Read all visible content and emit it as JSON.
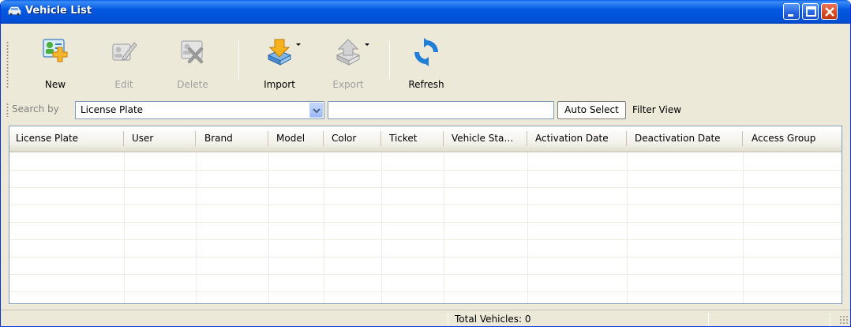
{
  "window": {
    "title": "Vehicle List",
    "icon": "car-icon"
  },
  "toolbar": {
    "buttons": [
      {
        "label": "New",
        "icon": "new-user-icon",
        "enabled": true
      },
      {
        "label": "Edit",
        "icon": "edit-icon",
        "enabled": false
      },
      {
        "label": "Delete",
        "icon": "delete-icon",
        "enabled": false
      },
      {
        "label": "Import",
        "icon": "import-icon",
        "enabled": true
      },
      {
        "label": "Export",
        "icon": "export-icon",
        "enabled": false
      },
      {
        "label": "Refresh",
        "icon": "refresh-icon",
        "enabled": true
      }
    ]
  },
  "search": {
    "label": "Search by",
    "field_value": "License Plate",
    "text_value": "",
    "auto_select_label": "Auto Select",
    "filter_view_label": "Filter View"
  },
  "table": {
    "columns": [
      "License Plate",
      "User",
      "Brand",
      "Model",
      "Color",
      "Ticket",
      "Vehicle Sta…",
      "Activation Date",
      "Deactivation Date",
      "Access Group"
    ],
    "rows": []
  },
  "status": {
    "total_text": "Total Vehicles: 0"
  },
  "colors": {
    "title_bar": "#0358e0",
    "window_bg": "#ece9d8",
    "close_button": "#d8481f"
  }
}
